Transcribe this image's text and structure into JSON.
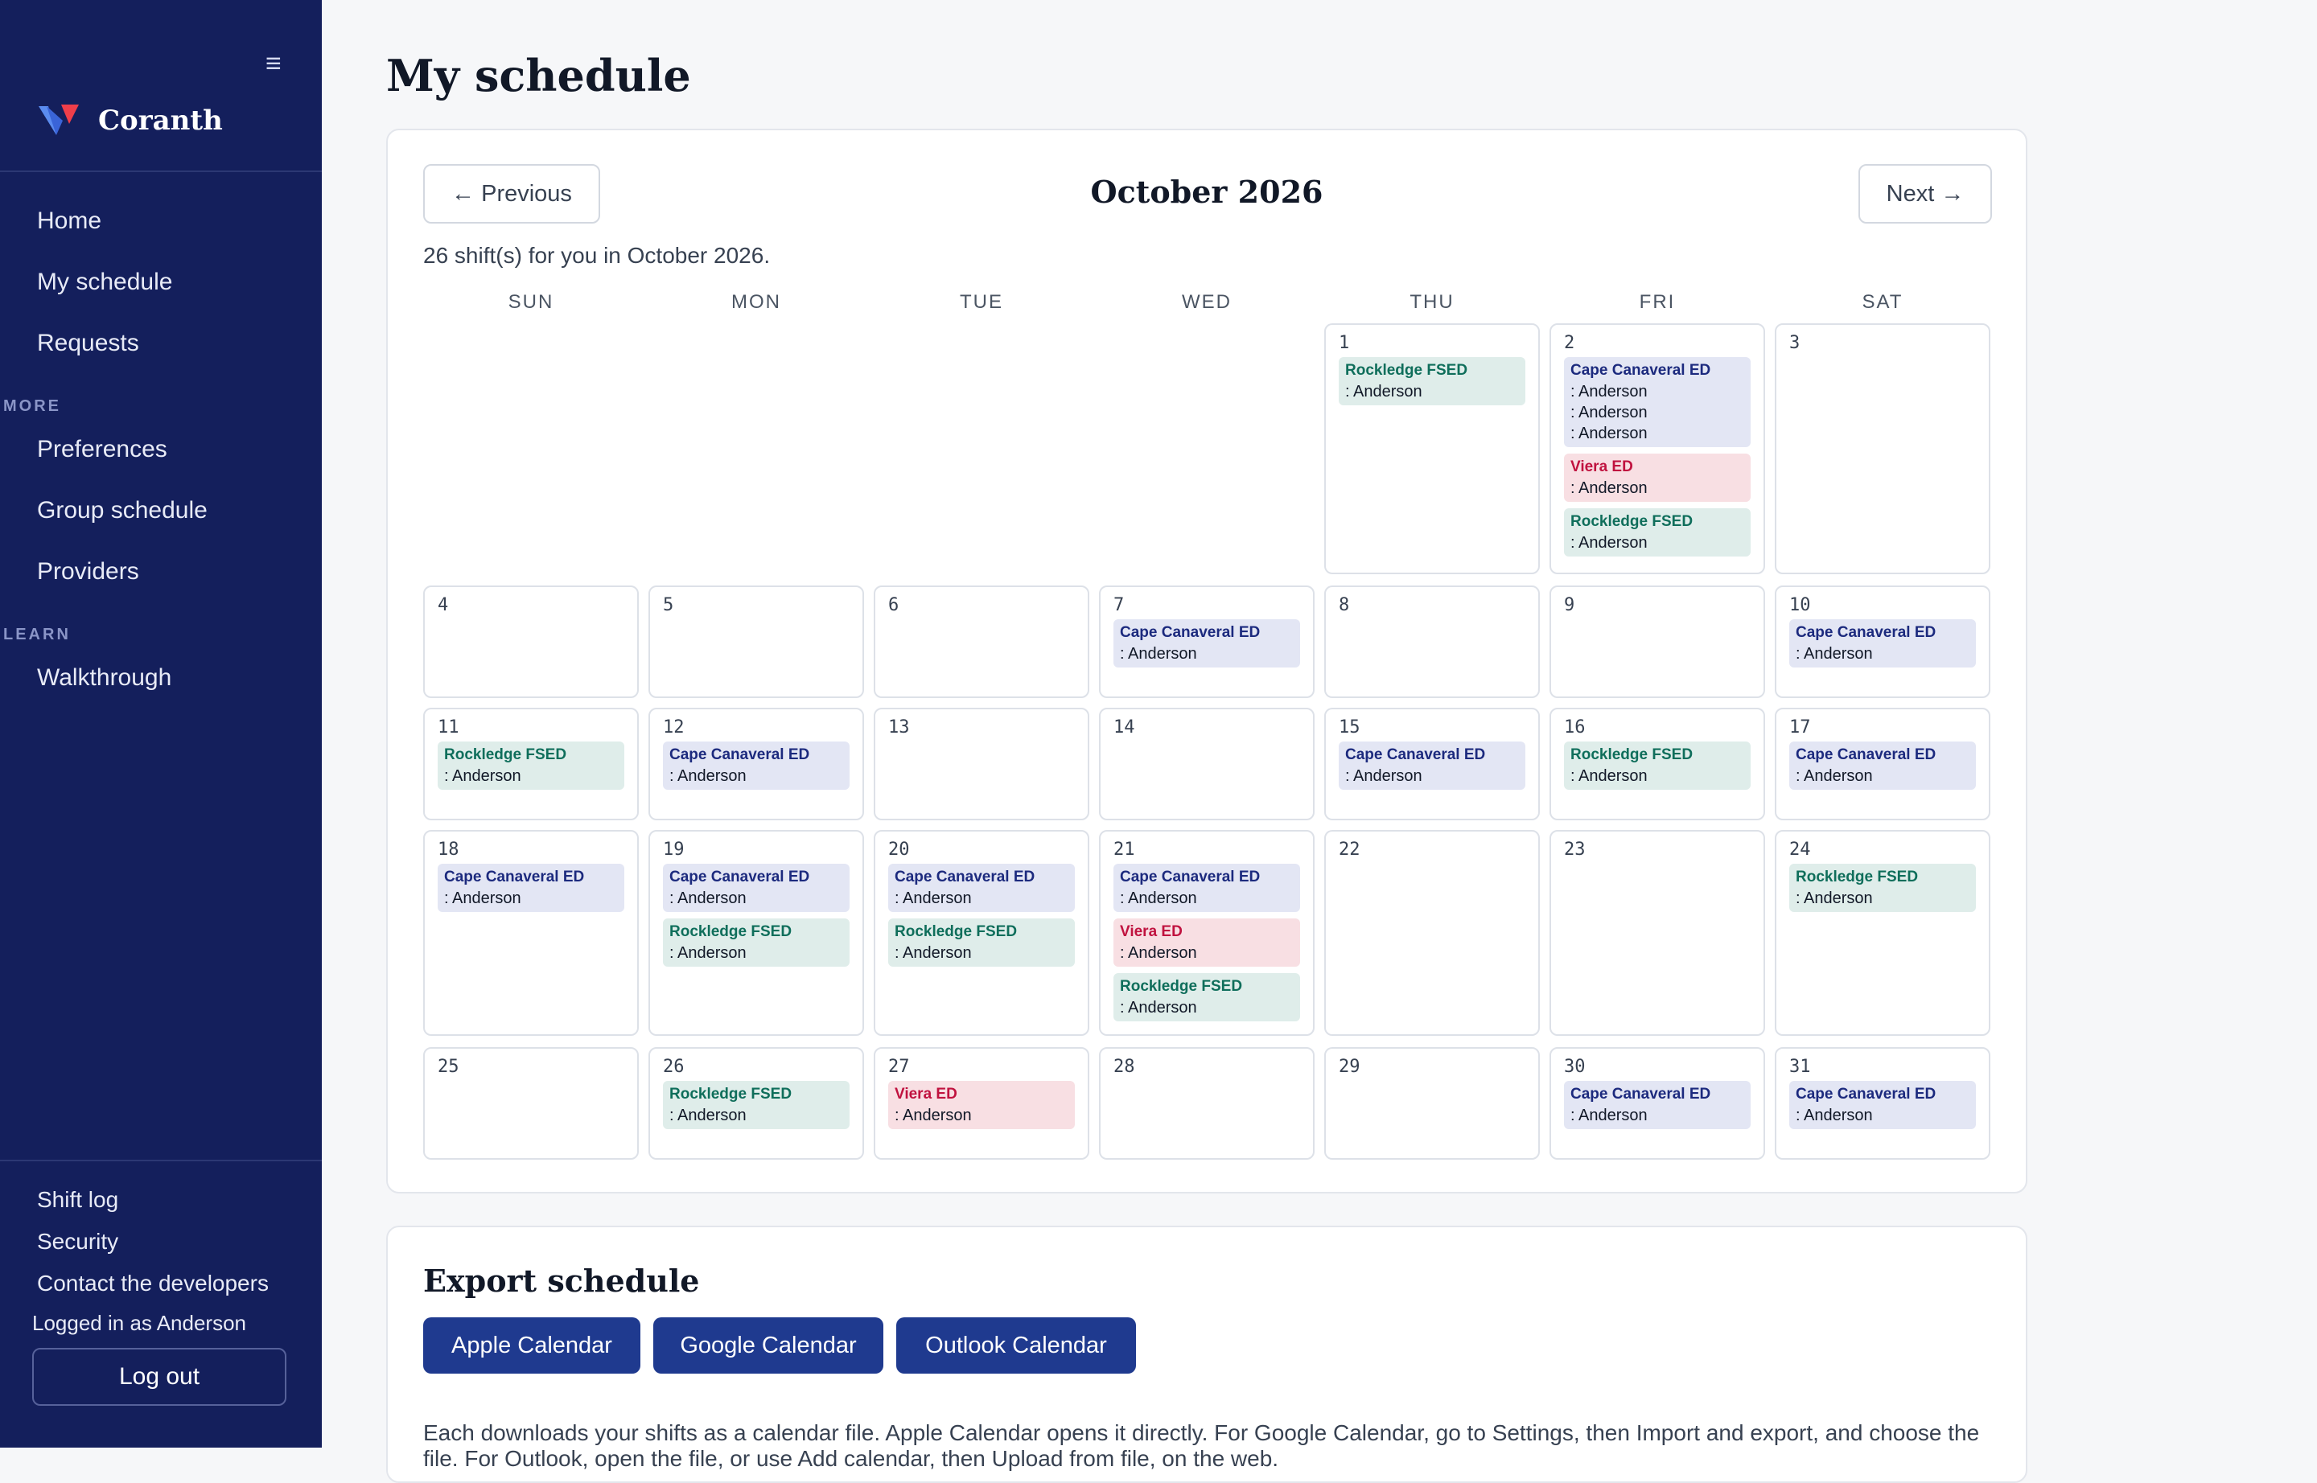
{
  "app": {
    "name": "Coranth",
    "menu_icon": "≡"
  },
  "sidebar": {
    "main_items": [
      "Home",
      "My schedule",
      "Requests"
    ],
    "more_label": "MORE",
    "more_items": [
      "Preferences",
      "Group schedule",
      "Providers"
    ],
    "learn_label": "LEARN",
    "learn_items": [
      "Walkthrough"
    ],
    "footer_links": [
      "Shift log",
      "Security",
      "Contact the developers"
    ],
    "logged_in": "Logged in as Anderson",
    "logout": "Log out"
  },
  "page": {
    "title": "My schedule"
  },
  "calendar": {
    "prev_label": "← Previous",
    "next_label": "Next →",
    "month_title": "October 2026",
    "summary": "26 shift(s) for you in October 2026.",
    "weekdays": [
      "SUN",
      "MON",
      "TUE",
      "WED",
      "THU",
      "FRI",
      "SAT"
    ],
    "first_weekday_index": 4,
    "days_in_month": 31,
    "shifts": {
      "1": [
        {
          "loc": "Rockledge FSED",
          "kind": "rock",
          "people": [
            ": Anderson"
          ]
        }
      ],
      "2": [
        {
          "loc": "Cape Canaveral ED",
          "kind": "cape",
          "people": [
            ": Anderson",
            ": Anderson",
            ": Anderson"
          ]
        },
        {
          "loc": "Viera ED",
          "kind": "viera",
          "people": [
            ": Anderson"
          ]
        },
        {
          "loc": "Rockledge FSED",
          "kind": "rock",
          "people": [
            ": Anderson"
          ]
        }
      ],
      "7": [
        {
          "loc": "Cape Canaveral ED",
          "kind": "cape",
          "people": [
            ": Anderson"
          ]
        }
      ],
      "10": [
        {
          "loc": "Cape Canaveral ED",
          "kind": "cape",
          "people": [
            ": Anderson"
          ]
        }
      ],
      "11": [
        {
          "loc": "Rockledge FSED",
          "kind": "rock",
          "people": [
            ": Anderson"
          ]
        }
      ],
      "12": [
        {
          "loc": "Cape Canaveral ED",
          "kind": "cape",
          "people": [
            ": Anderson"
          ]
        }
      ],
      "15": [
        {
          "loc": "Cape Canaveral ED",
          "kind": "cape",
          "people": [
            ": Anderson"
          ]
        }
      ],
      "16": [
        {
          "loc": "Rockledge FSED",
          "kind": "rock",
          "people": [
            ": Anderson"
          ]
        }
      ],
      "17": [
        {
          "loc": "Cape Canaveral ED",
          "kind": "cape",
          "people": [
            ": Anderson"
          ]
        }
      ],
      "18": [
        {
          "loc": "Cape Canaveral ED",
          "kind": "cape",
          "people": [
            ": Anderson"
          ]
        }
      ],
      "19": [
        {
          "loc": "Cape Canaveral ED",
          "kind": "cape",
          "people": [
            ": Anderson"
          ]
        },
        {
          "loc": "Rockledge FSED",
          "kind": "rock",
          "people": [
            ": Anderson"
          ]
        }
      ],
      "20": [
        {
          "loc": "Cape Canaveral ED",
          "kind": "cape",
          "people": [
            ": Anderson"
          ]
        },
        {
          "loc": "Rockledge FSED",
          "kind": "rock",
          "people": [
            ": Anderson"
          ]
        }
      ],
      "21": [
        {
          "loc": "Cape Canaveral ED",
          "kind": "cape",
          "people": [
            ": Anderson"
          ]
        },
        {
          "loc": "Viera ED",
          "kind": "viera",
          "people": [
            ": Anderson"
          ]
        },
        {
          "loc": "Rockledge FSED",
          "kind": "rock",
          "people": [
            ": Anderson"
          ]
        }
      ],
      "24": [
        {
          "loc": "Rockledge FSED",
          "kind": "rock",
          "people": [
            ": Anderson"
          ]
        }
      ],
      "26": [
        {
          "loc": "Rockledge FSED",
          "kind": "rock",
          "people": [
            ": Anderson"
          ]
        }
      ],
      "27": [
        {
          "loc": "Viera ED",
          "kind": "viera",
          "people": [
            ": Anderson"
          ]
        }
      ],
      "30": [
        {
          "loc": "Cape Canaveral ED",
          "kind": "cape",
          "people": [
            ": Anderson"
          ]
        }
      ],
      "31": [
        {
          "loc": "Cape Canaveral ED",
          "kind": "cape",
          "people": [
            ": Anderson"
          ]
        }
      ]
    }
  },
  "export": {
    "title": "Export schedule",
    "buttons": [
      "Apple Calendar",
      "Google Calendar",
      "Outlook Calendar"
    ],
    "description": "Each downloads your shifts as a calendar file. Apple Calendar opens it directly. For Google Calendar, go to Settings, then Import and export, and choose the file. For Outlook, open the file, or use Add calendar, then Upload from file, on the web."
  },
  "colors": {
    "sidebar_bg": "#141f5c",
    "primary_button": "#1f3a8f",
    "cape_bg": "#e3e6f4",
    "cape_text": "#1c2a7e",
    "viera_bg": "#f8dfe3",
    "viera_text": "#c0123f",
    "rockledge_bg": "#dfedea",
    "rockledge_text": "#0f6e5b"
  }
}
